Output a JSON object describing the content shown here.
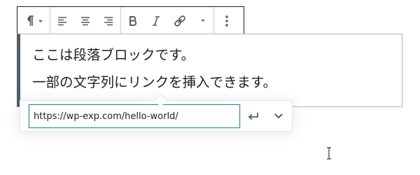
{
  "editor": {
    "paragraph": {
      "line1": "ここは段落ブロックです。",
      "line2": "一部の文字列にリンクを挿入できます。"
    }
  },
  "link_popover": {
    "url_value": "https://wp-exp.com/hello-world/"
  },
  "toolbar": {
    "icons": [
      "paragraph-icon",
      "chevron-down-icon",
      "align-left-icon",
      "align-center-icon",
      "align-right-icon",
      "bold-icon",
      "italic-icon",
      "link-icon",
      "chevron-down-icon",
      "more-options-icon"
    ]
  },
  "colors": {
    "accent": "#208a9e",
    "border_dark": "#1e1e1e",
    "block_left_border": "#555d66",
    "icon": "#555d66"
  }
}
